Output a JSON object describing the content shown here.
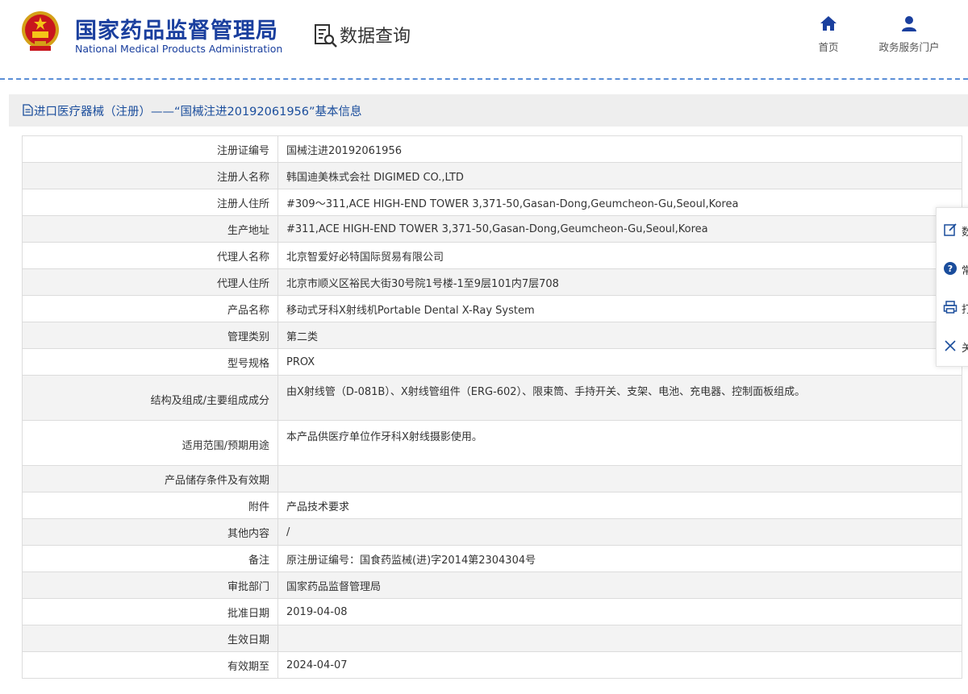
{
  "header": {
    "brand_cn": "国家药品监督管理局",
    "brand_en": "National Medical Products Administration",
    "section_title": "数据查询",
    "nav": [
      {
        "label": "首页",
        "icon": "home-icon"
      },
      {
        "label": "政务服务门户",
        "icon": "user-icon"
      }
    ],
    "brand_color": "#1a3f9e"
  },
  "page_title": "进口医疗器械（注册）——“国械注进20192061956”基本信息",
  "rows": [
    {
      "label": "注册证编号",
      "value": "国械注进20192061956"
    },
    {
      "label": "注册人名称",
      "value": "韩国迪美株式会社 DIGIMED CO.,LTD"
    },
    {
      "label": "注册人住所",
      "value": "#309～311,ACE HIGH-END TOWER 3,371-50,Gasan-Dong,Geumcheon-Gu,Seoul,Korea"
    },
    {
      "label": "生产地址",
      "value": "#311,ACE HIGH-END TOWER 3,371-50,Gasan-Dong,Geumcheon-Gu,Seoul,Korea"
    },
    {
      "label": "代理人名称",
      "value": "北京智爱好必特国际贸易有限公司"
    },
    {
      "label": "代理人住所",
      "value": "北京市顺义区裕民大街30号院1号楼-1至9层101内7层708"
    },
    {
      "label": "产品名称",
      "value": "移动式牙科X射线机Portable Dental X-Ray System"
    },
    {
      "label": "管理类别",
      "value": "第二类"
    },
    {
      "label": "型号规格",
      "value": "PROX"
    },
    {
      "label": "结构及组成/主要组成成分",
      "value": "由X射线管（D-081B）、X射线管组件（ERG-602）、限束筒、手持开关、支架、电池、充电器、控制面板组成。"
    },
    {
      "label": "适用范围/预期用途",
      "value": "本产品供医疗单位作牙科X射线摄影使用。"
    },
    {
      "label": "产品储存条件及有效期",
      "value": ""
    },
    {
      "label": "附件",
      "value": "产品技术要求"
    },
    {
      "label": "其他内容",
      "value": "/"
    },
    {
      "label": "备注",
      "value": "原注册证编号：国食药监械(进)字2014第2304304号"
    },
    {
      "label": "审批部门",
      "value": "国家药品监督管理局"
    },
    {
      "label": "批准日期",
      "value": "2019-04-08"
    },
    {
      "label": "生效日期",
      "value": ""
    },
    {
      "label": "有效期至",
      "value": "2024-04-07"
    }
  ],
  "side_toolbar": [
    {
      "label": "数",
      "icon": "edit-icon"
    },
    {
      "label": "常",
      "icon": "help-icon"
    },
    {
      "label": "打",
      "icon": "print-icon"
    },
    {
      "label": "关",
      "icon": "close-icon"
    }
  ]
}
